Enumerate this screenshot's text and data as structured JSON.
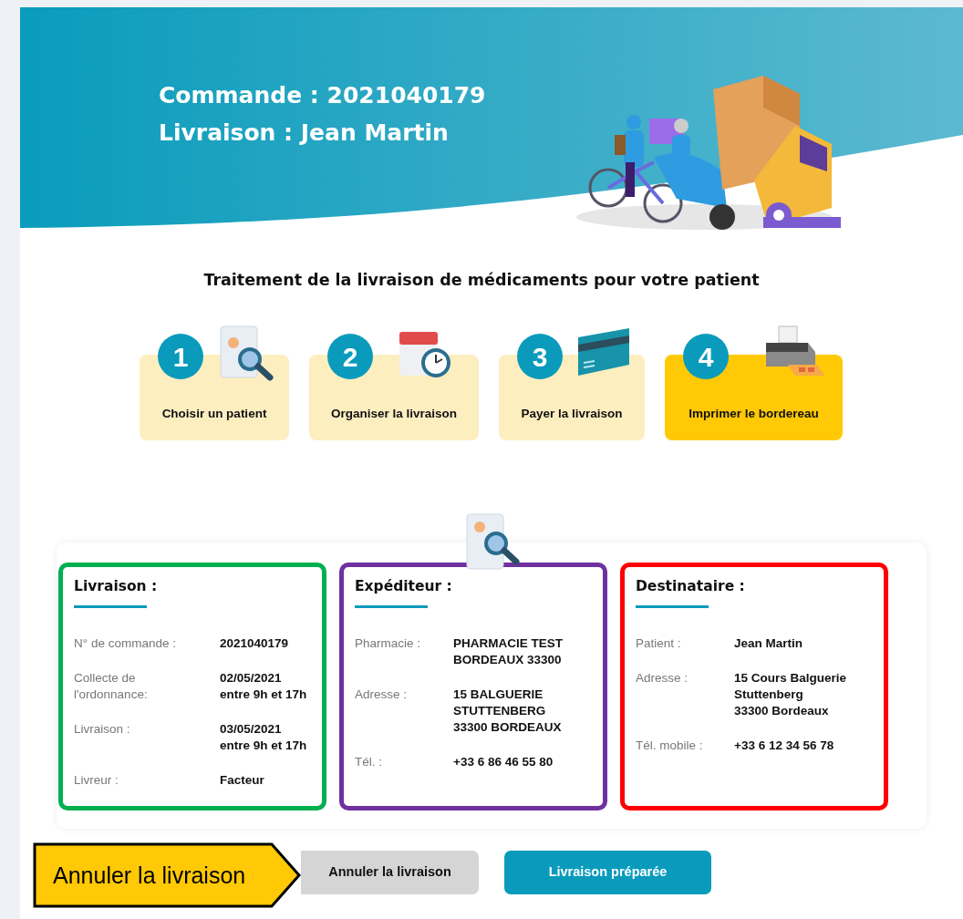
{
  "header": {
    "title_lines": [
      "Commande : 2021040179",
      "Livraison : Jean Martin"
    ]
  },
  "subtitle": "Traitement de la livraison de médicaments pour votre patient",
  "steps": [
    {
      "number": "1",
      "label": "Choisir un patient",
      "selected": false,
      "kind": "patient"
    },
    {
      "number": "2",
      "label": "Organiser la livraison",
      "selected": false,
      "kind": "calendar"
    },
    {
      "number": "3",
      "label": "Payer la livraison",
      "selected": false,
      "kind": "card"
    },
    {
      "number": "4",
      "label": "Imprimer le bordereau",
      "selected": true,
      "kind": "printer"
    }
  ],
  "cards": [
    {
      "title": "Livraison :",
      "color": "#00b050",
      "rows": [
        {
          "label": "N° de commande :",
          "value_lines": [
            "2021040179"
          ]
        },
        {
          "label": "Collecte de l'ordonnance:",
          "value_lines": [
            "02/05/2021",
            "entre 9h et 17h"
          ]
        },
        {
          "label": "Livraison :",
          "value_lines": [
            "03/05/2021",
            "entre 9h et 17h"
          ]
        },
        {
          "label": "Livreur :",
          "value_lines": [
            "Facteur"
          ]
        }
      ]
    },
    {
      "title": "Expéditeur :",
      "color": "#7030a0",
      "rows": [
        {
          "label": "Pharmacie :",
          "value_lines": [
            "PHARMACIE TEST",
            "BORDEAUX 33300"
          ]
        },
        {
          "label": "Adresse :",
          "value_lines": [
            "15 BALGUERIE",
            "STUTTENBERG",
            "33300 BORDEAUX"
          ]
        },
        {
          "label": "Tél. :",
          "value_lines": [
            "+33 6 86 46 55 80"
          ]
        }
      ]
    },
    {
      "title": "Destinataire :",
      "color": "#ff0000",
      "rows": [
        {
          "label": "Patient :",
          "value_lines": [
            "Jean Martin"
          ]
        },
        {
          "label": "Adresse :",
          "value_lines": [
            "15 Cours Balguerie",
            "Stuttenberg",
            "33300 Bordeaux"
          ]
        },
        {
          "label": "Tél. mobile :",
          "value_lines": [
            "+33 6 12 34 56 78"
          ]
        }
      ]
    }
  ],
  "buttons": [
    {
      "label": "Annuler la livraison",
      "kind": "secondary"
    },
    {
      "label": "Livraison préparée",
      "kind": "primary"
    }
  ],
  "callout": {
    "text": "Annuler la livraison"
  }
}
